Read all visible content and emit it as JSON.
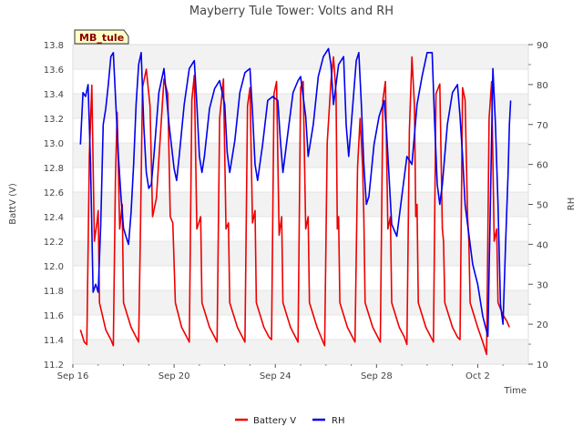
{
  "chart_data": {
    "type": "line",
    "title": "Mayberry Tule Tower: Volts and RH",
    "xlabel": "Time",
    "ylabel": "BattV (V)",
    "y2label": "RH",
    "station_tag": "MB_tule",
    "x_ticks": [
      "Sep 16",
      "Sep 20",
      "Sep 24",
      "Sep 28",
      "Oct 2"
    ],
    "x_tick_days": [
      0,
      4,
      8,
      12,
      16
    ],
    "x_range_days": [
      0,
      18
    ],
    "ylim": [
      11.2,
      13.8
    ],
    "y_ticks": [
      "11.2",
      "11.4",
      "11.6",
      "11.8",
      "12.0",
      "12.2",
      "12.4",
      "12.6",
      "12.8",
      "13.0",
      "13.2",
      "13.4",
      "13.6",
      "13.8"
    ],
    "y2lim": [
      10,
      90
    ],
    "y2_ticks": [
      "10",
      "20",
      "30",
      "40",
      "50",
      "60",
      "70",
      "80",
      "90"
    ],
    "grid": "horizontal bands",
    "legend_position": "bottom-center",
    "series": [
      {
        "name": "Battery V",
        "axis": "left",
        "color": "#ee0000",
        "points": [
          [
            0.3,
            11.48
          ],
          [
            0.45,
            11.38
          ],
          [
            0.55,
            11.36
          ],
          [
            0.65,
            12.9
          ],
          [
            0.75,
            13.47
          ],
          [
            0.85,
            12.2
          ],
          [
            0.95,
            12.35
          ],
          [
            1.0,
            12.45
          ],
          [
            1.05,
            11.7
          ],
          [
            1.3,
            11.48
          ],
          [
            1.5,
            11.4
          ],
          [
            1.6,
            11.35
          ],
          [
            1.68,
            12.7
          ],
          [
            1.75,
            13.25
          ],
          [
            1.85,
            12.3
          ],
          [
            1.95,
            12.5
          ],
          [
            2.0,
            11.7
          ],
          [
            2.3,
            11.5
          ],
          [
            2.5,
            11.42
          ],
          [
            2.6,
            11.38
          ],
          [
            2.68,
            12.4
          ],
          [
            2.75,
            13.45
          ],
          [
            2.9,
            13.6
          ],
          [
            3.05,
            13.3
          ],
          [
            3.15,
            12.4
          ],
          [
            3.3,
            12.55
          ],
          [
            3.6,
            13.52
          ],
          [
            3.75,
            13.4
          ],
          [
            3.85,
            12.4
          ],
          [
            3.95,
            12.35
          ],
          [
            4.05,
            11.7
          ],
          [
            4.3,
            11.5
          ],
          [
            4.5,
            11.42
          ],
          [
            4.6,
            11.38
          ],
          [
            4.7,
            13.35
          ],
          [
            4.8,
            13.55
          ],
          [
            4.9,
            12.3
          ],
          [
            5.05,
            12.4
          ],
          [
            5.1,
            11.7
          ],
          [
            5.4,
            11.5
          ],
          [
            5.6,
            11.42
          ],
          [
            5.7,
            11.38
          ],
          [
            5.8,
            13.2
          ],
          [
            5.95,
            13.52
          ],
          [
            6.05,
            12.3
          ],
          [
            6.15,
            12.35
          ],
          [
            6.2,
            11.7
          ],
          [
            6.5,
            11.5
          ],
          [
            6.7,
            11.42
          ],
          [
            6.8,
            11.38
          ],
          [
            6.9,
            13.3
          ],
          [
            7.0,
            13.45
          ],
          [
            7.1,
            12.35
          ],
          [
            7.2,
            12.45
          ],
          [
            7.25,
            11.7
          ],
          [
            7.55,
            11.5
          ],
          [
            7.75,
            11.42
          ],
          [
            7.85,
            11.4
          ],
          [
            7.95,
            13.4
          ],
          [
            8.05,
            13.5
          ],
          [
            8.15,
            12.25
          ],
          [
            8.25,
            12.4
          ],
          [
            8.3,
            11.7
          ],
          [
            8.6,
            11.5
          ],
          [
            8.8,
            11.42
          ],
          [
            8.9,
            11.38
          ],
          [
            9.0,
            13.45
          ],
          [
            9.1,
            13.5
          ],
          [
            9.2,
            12.3
          ],
          [
            9.3,
            12.4
          ],
          [
            9.35,
            11.7
          ],
          [
            9.65,
            11.5
          ],
          [
            9.85,
            11.4
          ],
          [
            9.95,
            11.35
          ],
          [
            10.05,
            13.0
          ],
          [
            10.2,
            13.5
          ],
          [
            10.3,
            13.7
          ],
          [
            10.4,
            13.4
          ],
          [
            10.45,
            12.3
          ],
          [
            10.5,
            12.4
          ],
          [
            10.55,
            11.7
          ],
          [
            10.85,
            11.5
          ],
          [
            11.05,
            11.42
          ],
          [
            11.15,
            11.38
          ],
          [
            11.25,
            12.8
          ],
          [
            11.35,
            13.2
          ],
          [
            11.45,
            12.8
          ],
          [
            11.5,
            12.4
          ],
          [
            11.55,
            11.7
          ],
          [
            11.85,
            11.5
          ],
          [
            12.05,
            11.42
          ],
          [
            12.15,
            11.38
          ],
          [
            12.25,
            13.35
          ],
          [
            12.35,
            13.5
          ],
          [
            12.45,
            12.3
          ],
          [
            12.55,
            12.4
          ],
          [
            12.6,
            11.7
          ],
          [
            12.9,
            11.5
          ],
          [
            13.1,
            11.42
          ],
          [
            13.2,
            11.36
          ],
          [
            13.3,
            13.1
          ],
          [
            13.4,
            13.7
          ],
          [
            13.5,
            13.3
          ],
          [
            13.55,
            12.4
          ],
          [
            13.6,
            12.5
          ],
          [
            13.65,
            11.7
          ],
          [
            13.95,
            11.5
          ],
          [
            14.15,
            11.42
          ],
          [
            14.25,
            11.38
          ],
          [
            14.35,
            13.4
          ],
          [
            14.5,
            13.48
          ],
          [
            14.6,
            12.3
          ],
          [
            14.65,
            12.2
          ],
          [
            14.7,
            11.7
          ],
          [
            15.0,
            11.5
          ],
          [
            15.2,
            11.42
          ],
          [
            15.3,
            11.4
          ],
          [
            15.4,
            13.45
          ],
          [
            15.5,
            13.35
          ],
          [
            15.6,
            12.4
          ],
          [
            15.65,
            12.2
          ],
          [
            15.7,
            11.7
          ],
          [
            16.0,
            11.5
          ],
          [
            16.2,
            11.38
          ],
          [
            16.35,
            11.28
          ],
          [
            16.45,
            13.2
          ],
          [
            16.55,
            13.5
          ],
          [
            16.65,
            12.2
          ],
          [
            16.75,
            12.3
          ],
          [
            16.8,
            11.7
          ],
          [
            17.0,
            11.6
          ],
          [
            17.15,
            11.55
          ],
          [
            17.25,
            11.5
          ]
        ]
      },
      {
        "name": "RH",
        "axis": "right",
        "color": "#0000ee",
        "points": [
          [
            0.3,
            65
          ],
          [
            0.4,
            78
          ],
          [
            0.5,
            77
          ],
          [
            0.6,
            80
          ],
          [
            0.7,
            60
          ],
          [
            0.8,
            28
          ],
          [
            0.9,
            30
          ],
          [
            1.0,
            28
          ],
          [
            1.1,
            45
          ],
          [
            1.2,
            70
          ],
          [
            1.3,
            74
          ],
          [
            1.4,
            80
          ],
          [
            1.5,
            87
          ],
          [
            1.6,
            88
          ],
          [
            1.7,
            75
          ],
          [
            1.8,
            62
          ],
          [
            1.9,
            52
          ],
          [
            2.0,
            44
          ],
          [
            2.1,
            42
          ],
          [
            2.2,
            40
          ],
          [
            2.3,
            48
          ],
          [
            2.4,
            60
          ],
          [
            2.5,
            75
          ],
          [
            2.6,
            85
          ],
          [
            2.7,
            88
          ],
          [
            2.8,
            70
          ],
          [
            2.9,
            58
          ],
          [
            3.0,
            54
          ],
          [
            3.1,
            55
          ],
          [
            3.2,
            62
          ],
          [
            3.4,
            78
          ],
          [
            3.6,
            84
          ],
          [
            3.8,
            70
          ],
          [
            4.0,
            59
          ],
          [
            4.1,
            56
          ],
          [
            4.2,
            62
          ],
          [
            4.4,
            75
          ],
          [
            4.6,
            84
          ],
          [
            4.8,
            86
          ],
          [
            4.9,
            75
          ],
          [
            5.0,
            62
          ],
          [
            5.1,
            58
          ],
          [
            5.2,
            62
          ],
          [
            5.4,
            74
          ],
          [
            5.6,
            79
          ],
          [
            5.8,
            81
          ],
          [
            6.0,
            75
          ],
          [
            6.1,
            63
          ],
          [
            6.2,
            58
          ],
          [
            6.4,
            66
          ],
          [
            6.6,
            78
          ],
          [
            6.8,
            83
          ],
          [
            7.0,
            84
          ],
          [
            7.1,
            73
          ],
          [
            7.2,
            60
          ],
          [
            7.3,
            56
          ],
          [
            7.5,
            65
          ],
          [
            7.7,
            76
          ],
          [
            7.9,
            77
          ],
          [
            8.1,
            76
          ],
          [
            8.2,
            66
          ],
          [
            8.3,
            58
          ],
          [
            8.5,
            68
          ],
          [
            8.7,
            78
          ],
          [
            8.9,
            81
          ],
          [
            9.0,
            82
          ],
          [
            9.2,
            72
          ],
          [
            9.3,
            62
          ],
          [
            9.5,
            70
          ],
          [
            9.7,
            82
          ],
          [
            9.9,
            87
          ],
          [
            10.1,
            89
          ],
          [
            10.2,
            85
          ],
          [
            10.3,
            75
          ],
          [
            10.5,
            85
          ],
          [
            10.7,
            87
          ],
          [
            10.8,
            70
          ],
          [
            10.9,
            62
          ],
          [
            11.0,
            70
          ],
          [
            11.2,
            86
          ],
          [
            11.3,
            88
          ],
          [
            11.4,
            75
          ],
          [
            11.5,
            60
          ],
          [
            11.6,
            50
          ],
          [
            11.7,
            52
          ],
          [
            11.9,
            65
          ],
          [
            12.1,
            72
          ],
          [
            12.3,
            76
          ],
          [
            12.4,
            68
          ],
          [
            12.6,
            45
          ],
          [
            12.8,
            42
          ],
          [
            13.0,
            52
          ],
          [
            13.2,
            62
          ],
          [
            13.4,
            60
          ],
          [
            13.6,
            75
          ],
          [
            13.8,
            82
          ],
          [
            14.0,
            88
          ],
          [
            14.2,
            88
          ],
          [
            14.3,
            70
          ],
          [
            14.4,
            55
          ],
          [
            14.5,
            50
          ],
          [
            14.6,
            55
          ],
          [
            14.8,
            70
          ],
          [
            15.0,
            78
          ],
          [
            15.2,
            80
          ],
          [
            15.3,
            72
          ],
          [
            15.4,
            62
          ],
          [
            15.5,
            50
          ],
          [
            15.6,
            45
          ],
          [
            15.8,
            35
          ],
          [
            16.0,
            30
          ],
          [
            16.2,
            22
          ],
          [
            16.4,
            17
          ],
          [
            16.5,
            50
          ],
          [
            16.6,
            84
          ],
          [
            16.7,
            70
          ],
          [
            16.8,
            50
          ],
          [
            16.9,
            25
          ],
          [
            17.0,
            20
          ],
          [
            17.1,
            40
          ],
          [
            17.2,
            58
          ],
          [
            17.25,
            70
          ],
          [
            17.3,
            76
          ]
        ]
      }
    ]
  }
}
